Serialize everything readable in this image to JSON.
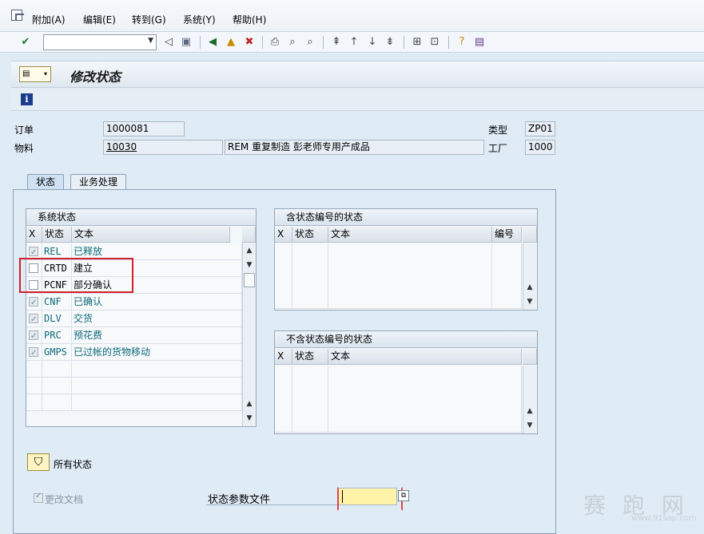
{
  "menubar": {
    "items": [
      "附加(A)",
      "编辑(E)",
      "转到(G)",
      "系统(Y)",
      "帮助(H)"
    ]
  },
  "toolbar": {
    "command_field_value": ""
  },
  "title": "修改状态",
  "header": {
    "order_label": "订单",
    "order_value": "1000081",
    "material_label": "物料",
    "material_value": "10030",
    "material_desc": "REM 重复制造 彭老师专用产成品",
    "type_label": "类型",
    "type_value": "ZP01",
    "plant_label": "工厂",
    "plant_value": "1000"
  },
  "tabs": [
    "状态",
    "业务处理"
  ],
  "system_status": {
    "title": "系统状态",
    "columns": [
      "X",
      "状态",
      "文本"
    ],
    "rows": [
      {
        "checked": true,
        "status": "REL",
        "text": "已释放",
        "active": true
      },
      {
        "checked": false,
        "status": "CRTD",
        "text": "建立",
        "active": false
      },
      {
        "checked": false,
        "status": "PCNF",
        "text": "部分确认",
        "active": false
      },
      {
        "checked": true,
        "status": "CNF",
        "text": "已确认",
        "active": true
      },
      {
        "checked": true,
        "status": "DLV",
        "text": "交货",
        "active": true
      },
      {
        "checked": true,
        "status": "PRC",
        "text": "预花费",
        "active": true
      },
      {
        "checked": true,
        "status": "GMPS",
        "text": "已过帐的货物移动",
        "active": true
      }
    ]
  },
  "status_with_number": {
    "title": "含状态编号的状态",
    "columns": [
      "X",
      "状态",
      "文本",
      "编号"
    ]
  },
  "status_without_number": {
    "title": "不含状态编号的状态",
    "columns": [
      "X",
      "状态",
      "文本"
    ]
  },
  "bottom": {
    "all_status_label": "所有状态",
    "change_docs_label": "更改文档",
    "status_profile_label": "状态参数文件",
    "status_profile_value": ""
  },
  "watermark": {
    "brand": "赛 跑 网",
    "url": "www.91sap.com"
  },
  "icons": [
    "system-menu-icon",
    "check-icon",
    "back-icon",
    "save-icon",
    "nav-back-icon",
    "exit-icon",
    "cancel-icon",
    "print-icon",
    "find-icon",
    "find-next-icon",
    "first-page-icon",
    "prev-page-icon",
    "next-page-icon",
    "last-page-icon",
    "new-session-icon",
    "shortcut-icon",
    "help-icon",
    "layout-icon",
    "info-icon",
    "filter-icon",
    "f4-help-icon"
  ]
}
